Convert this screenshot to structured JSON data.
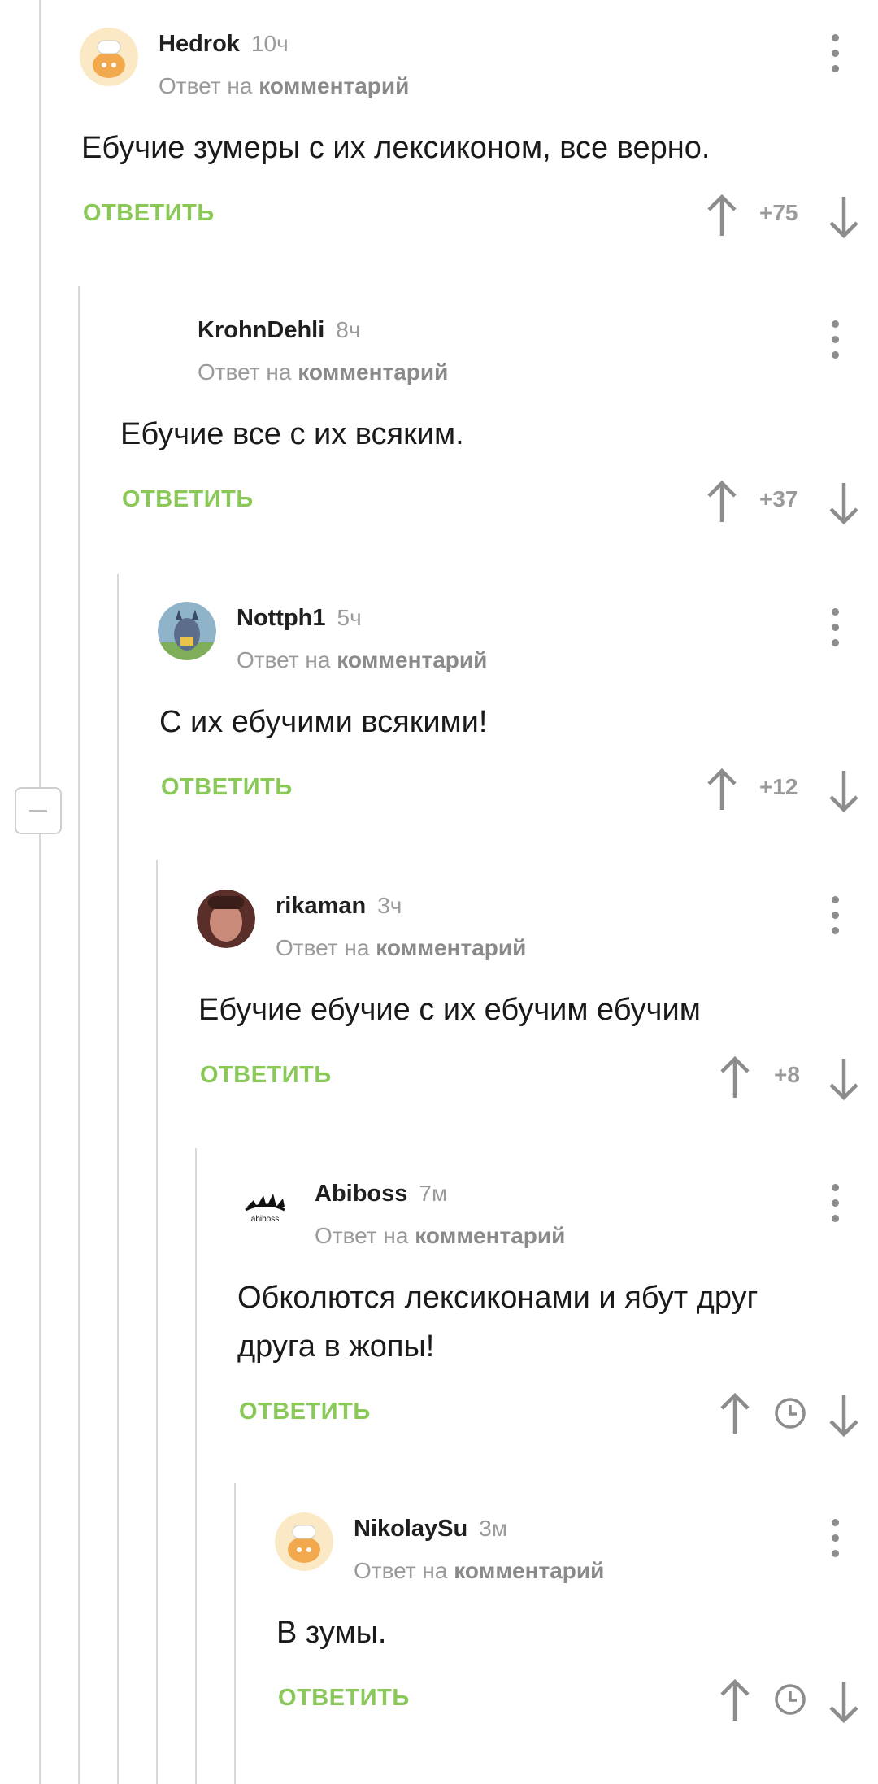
{
  "comments": [
    {
      "author": "Hedrok",
      "time": "10ч",
      "reply_prefix": "Ответ на",
      "reply_link": "комментарий",
      "text": "Ебучие зумеры с их лексиконом, все верно.",
      "answer": "ОТВЕТИТЬ",
      "score": "+75",
      "avatar": "chef-avatar"
    },
    {
      "author": "KrohnDehli",
      "time": "8ч",
      "reply_prefix": "Ответ на",
      "reply_link": "комментарий",
      "text": "Ебучие все с их всяким.",
      "answer": "ОТВЕТИТЬ",
      "score": "+37",
      "avatar": "none"
    },
    {
      "author": "Nottph1",
      "time": "5ч",
      "reply_prefix": "Ответ на",
      "reply_link": "комментарий",
      "text": "С их ебучими всякими!",
      "answer": "ОТВЕТИТЬ",
      "score": "+12",
      "avatar": "batman-avatar"
    },
    {
      "author": "rikaman",
      "time": "3ч",
      "reply_prefix": "Ответ на",
      "reply_link": "комментарий",
      "text": "Ебучие ебучие с их ебучим ебучим",
      "answer": "ОТВЕТИТЬ",
      "score": "+8",
      "avatar": "photo-avatar"
    },
    {
      "author": "Abiboss",
      "time": "7м",
      "reply_prefix": "Ответ на",
      "reply_link": "комментарий",
      "text_line1": "Обколются лексиконами и ябут друг",
      "text_line2": "друга в жопы!",
      "answer": "ОТВЕТИТЬ",
      "score_icon": "clock-icon",
      "avatar": "logo-avatar",
      "logo_text": "abiboss"
    },
    {
      "author": "NikolaySu",
      "time": "3м",
      "reply_prefix": "Ответ на",
      "reply_link": "комментарий",
      "text": "В зумы.",
      "answer": "ОТВЕТИТЬ",
      "score_icon": "clock-icon",
      "avatar": "chef-avatar"
    }
  ],
  "colors": {
    "accent": "#8ac858",
    "muted": "#9a9a9a",
    "line": "#d9d9d9"
  }
}
